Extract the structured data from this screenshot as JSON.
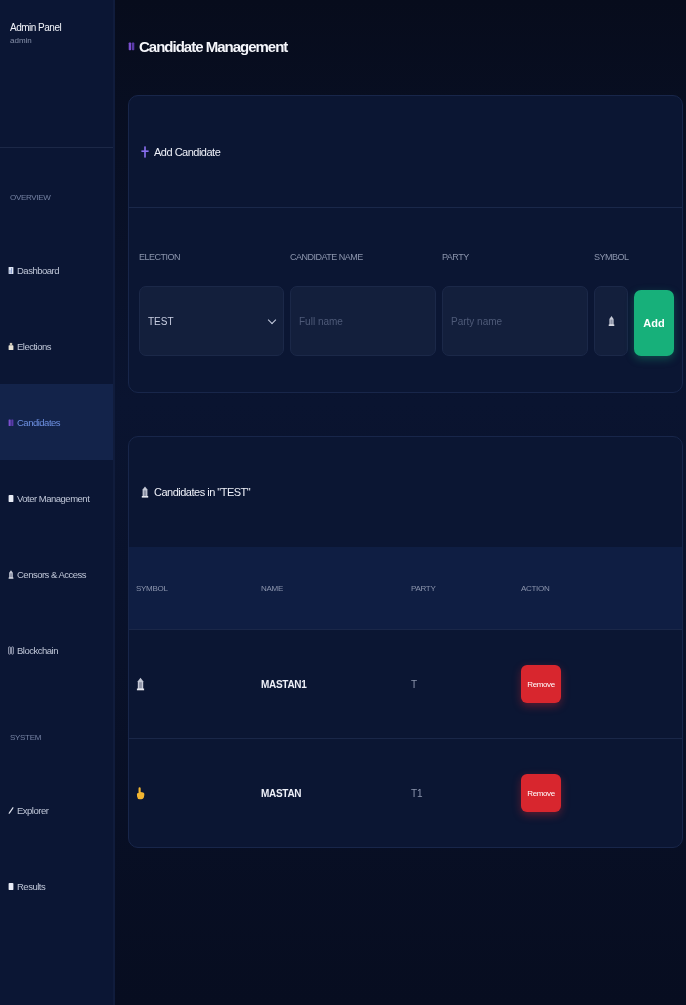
{
  "sidebar": {
    "title": "Admin Panel",
    "user": "admin",
    "sections": [
      {
        "heading": "OVERVIEW",
        "items": [
          {
            "label": "Dashboard",
            "selected": false
          },
          {
            "label": "Elections",
            "selected": false
          },
          {
            "label": "Candidates",
            "selected": true
          },
          {
            "label": "Voter Management",
            "selected": false
          },
          {
            "label": "Censors & Access",
            "selected": false
          },
          {
            "label": "Blockchain",
            "selected": false
          }
        ]
      },
      {
        "heading": "SYSTEM",
        "items": [
          {
            "label": "Explorer",
            "selected": false
          },
          {
            "label": "Results",
            "selected": false
          }
        ]
      }
    ]
  },
  "page_title": "Candidate Management",
  "add_card": {
    "title": "Add Candidate",
    "fields": [
      {
        "kind": "select",
        "label": "ELECTION",
        "value": "TEST"
      },
      {
        "kind": "text",
        "label": "CANDIDATE NAME",
        "placeholder": "Full name"
      },
      {
        "kind": "text",
        "label": "PARTY",
        "placeholder": "Party name"
      },
      {
        "kind": "symbol",
        "label": "SYMBOL"
      }
    ],
    "button": "Add"
  },
  "list_card": {
    "title": "Candidates in \"TEST\"",
    "columns": [
      "SYMBOL",
      "NAME",
      "PARTY",
      "ACTION"
    ],
    "rows": [
      {
        "kind": "tower",
        "name": "MASTAN1",
        "party": "T",
        "action": "Remove"
      },
      {
        "kind": "hand",
        "name": "MASTAN",
        "party": "T1",
        "action": "Remove"
      }
    ]
  }
}
